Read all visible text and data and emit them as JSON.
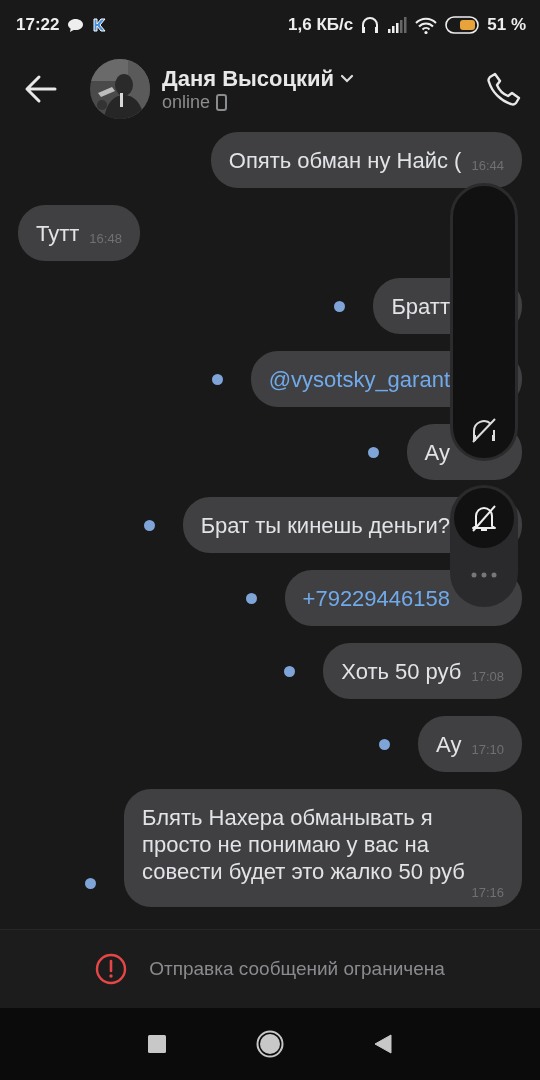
{
  "status_bar": {
    "time": "17:22",
    "speed": "1,6 КБ/с",
    "battery": "51 %"
  },
  "header": {
    "name": "Даня Высоцкий",
    "status": "online"
  },
  "messages": [
    {
      "outgoing": true,
      "unread": false,
      "text": "Опять обман ну Найс (",
      "time": "16:44",
      "link": false
    },
    {
      "outgoing": false,
      "text": "Тутт",
      "time": "16:48",
      "link": false
    },
    {
      "outgoing": true,
      "unread": true,
      "text": "Братт",
      "link": false
    },
    {
      "outgoing": true,
      "unread": true,
      "text": "@vysotsky_garant",
      "link": true
    },
    {
      "outgoing": true,
      "unread": true,
      "text": "Ау",
      "link": false
    },
    {
      "outgoing": true,
      "unread": true,
      "text": "Брат ты кинешь деньги?",
      "link": false
    },
    {
      "outgoing": true,
      "unread": true,
      "text": "+79229446158",
      "link": true
    },
    {
      "outgoing": true,
      "unread": true,
      "text": "Хоть 50 руб",
      "time": "17:08",
      "link": false
    },
    {
      "outgoing": true,
      "unread": true,
      "text": "Ау",
      "time": "17:10",
      "link": false
    },
    {
      "outgoing": true,
      "unread": true,
      "text": "Блять Нахера обманывать я просто не понимаю у вас на совести будет это жалко 50 руб",
      "time": "17:16",
      "link": false
    }
  ],
  "notice": "Отправка сообщений ограничена"
}
